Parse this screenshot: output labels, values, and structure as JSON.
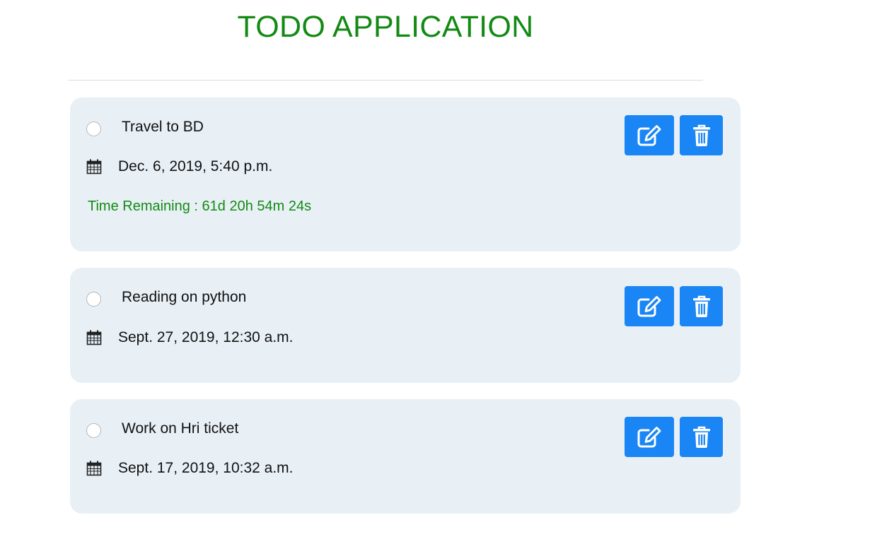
{
  "app": {
    "title": "TODO APPLICATION"
  },
  "todos": [
    {
      "title": "Travel to BD",
      "date": "Dec. 6, 2019, 5:40 p.m.",
      "time_remaining": "Time Remaining : 61d 20h 54m 24s",
      "completed": false
    },
    {
      "title": "Reading on python",
      "date": "Sept. 27, 2019, 12:30 a.m.",
      "completed": false
    },
    {
      "title": "Work on Hri ticket",
      "date": "Sept. 17, 2019, 10:32 a.m.",
      "completed": false
    }
  ],
  "icons": {
    "checkbox": "circle-checkbox-icon",
    "date": "calendar-icon",
    "edit": "edit-icon",
    "delete": "trash-icon"
  },
  "colors": {
    "title": "#138a13",
    "time_remaining": "#138a13",
    "card_background": "#e8f0f6",
    "button": "#1a86f5"
  }
}
